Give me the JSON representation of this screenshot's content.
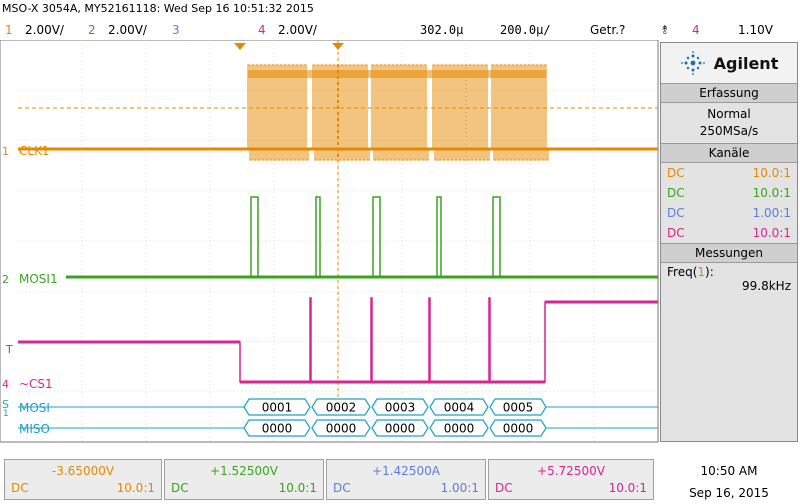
{
  "header": {
    "title": "MSO-X 3054A, MY52161118: Wed Sep 16 10:51:32 2015"
  },
  "channels": [
    {
      "num": "1",
      "scale": "2.00V/",
      "color": "#e58a00"
    },
    {
      "num": "2",
      "scale": "2.00V/",
      "color": "#3aa320"
    },
    {
      "num": "3",
      "scale": "",
      "color": "#5b7fd6"
    },
    {
      "num": "4",
      "scale": "2.00V/",
      "color": "#d6268f"
    }
  ],
  "timebase": {
    "delay": "302.0µ",
    "scale": "200.0µ/",
    "trigger_mode": "Getr.?",
    "trigger_source": "4",
    "trigger_level": "1.10V"
  },
  "panel": {
    "brand": "Agilent",
    "acquisition": {
      "header": "Erfassung",
      "mode": "Normal",
      "rate": "250MSa/s"
    },
    "channels": {
      "header": "Kanäle",
      "rows": [
        {
          "coupling": "DC",
          "ratio": "10.0:1",
          "color": "#e58a00"
        },
        {
          "coupling": "DC",
          "ratio": "10.0:1",
          "color": "#3aa320"
        },
        {
          "coupling": "DC",
          "ratio": "1.00:1",
          "color": "#5b7fd6"
        },
        {
          "coupling": "DC",
          "ratio": "10.0:1",
          "color": "#d6268f"
        }
      ]
    },
    "measurements": {
      "header": "Messungen",
      "label": "Freq(",
      "source": "1",
      "close": "):",
      "value": "99.8kHz"
    }
  },
  "traces": {
    "clk_label": "CLK1",
    "mosi_label": "MOSI1",
    "cs_label": "~CS1",
    "serial_label": "S",
    "serial_sub": "1",
    "trigger_marker": "T",
    "bus_mosi_label": "MOSI",
    "bus_miso_label": "MISO",
    "mosi_words": [
      "0001",
      "0002",
      "0003",
      "0004",
      "0005"
    ],
    "miso_words": [
      "0000",
      "0000",
      "0000",
      "0000",
      "0000"
    ]
  },
  "bottom": [
    {
      "value": "-3.65000V",
      "coupling": "DC",
      "ratio": "10.0:1",
      "color": "#e58a00"
    },
    {
      "value": "+1.52500V",
      "coupling": "DC",
      "ratio": "10.0:1",
      "color": "#3aa320"
    },
    {
      "value": "+1.42500A",
      "coupling": "DC",
      "ratio": "1.00:1",
      "color": "#5b7fd6"
    },
    {
      "value": "+5.72500V",
      "coupling": "DC",
      "ratio": "10.0:1",
      "color": "#d6268f"
    }
  ],
  "clock": {
    "time": "10:50 AM",
    "date": "Sep 16, 2015"
  }
}
